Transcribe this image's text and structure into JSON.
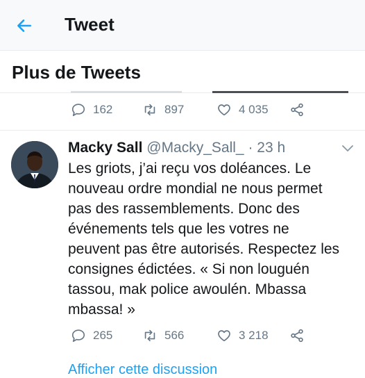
{
  "header": {
    "title": "Tweet",
    "back_icon": "arrow-left-icon",
    "accent": "#1da1f2"
  },
  "section": {
    "title": "Plus de Tweets"
  },
  "previous_tweet": {
    "replies": "162",
    "retweets": "897",
    "likes": "4 035"
  },
  "tweet": {
    "name": "Macky Sall",
    "handle": "@Macky_Sall_",
    "time": " · 23 h",
    "text": "Les griots, j’ai reçu vos doléances. Le\nnouveau ordre mondial ne nous permet\npas des rassemblements. Donc des\névénements tels que les votres ne\npeuvent pas être autorisés. Respectez les\nconsignes édictées. « Si non louguén\ntassou, mak police awoulén. Mbassa\nmbassa! »",
    "replies": "265",
    "retweets": "566",
    "likes": "3 218"
  },
  "show_thread": "Afficher cette discussion",
  "colors": {
    "text": "#14171a",
    "muted": "#657786",
    "border": "#e6ecf0"
  }
}
